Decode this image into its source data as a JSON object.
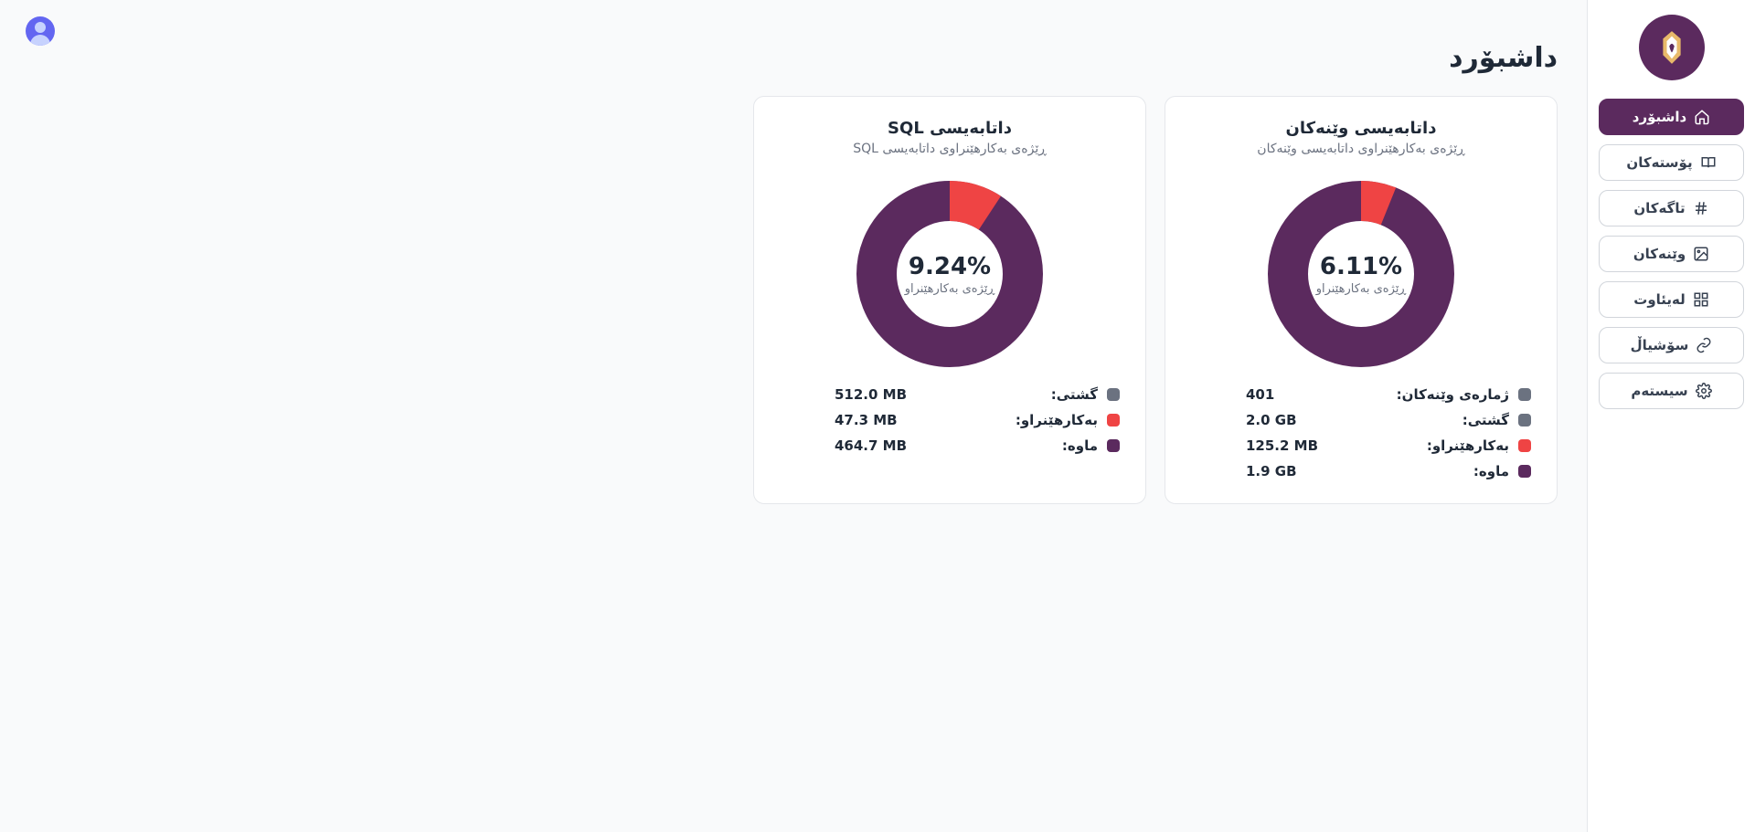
{
  "colors": {
    "primary": "#5b2a5e",
    "accent": "#ef4444",
    "muted": "#6b7280",
    "swatch_total": "#6b7280",
    "swatch_used": "#ef4444",
    "swatch_remaining": "#5b2a5e"
  },
  "page": {
    "title": "داشبۆرد"
  },
  "sidebar": {
    "items": [
      {
        "id": "dashboard",
        "label": "داشبۆرد",
        "icon": "home",
        "active": true
      },
      {
        "id": "posts",
        "label": "پۆستەکان",
        "icon": "book",
        "active": false
      },
      {
        "id": "tags",
        "label": "تاگەکان",
        "icon": "hash",
        "active": false
      },
      {
        "id": "images",
        "label": "وێنەکان",
        "icon": "image",
        "active": false
      },
      {
        "id": "categories",
        "label": "لەیئاوت",
        "icon": "grid",
        "active": false
      },
      {
        "id": "social",
        "label": "سۆشیاڵ",
        "icon": "link",
        "active": false
      },
      {
        "id": "system",
        "label": "سیستەم",
        "icon": "gear",
        "active": false
      }
    ]
  },
  "cards": [
    {
      "id": "images_db",
      "title": "داتابەیسی وێنەکان",
      "subtitle": "ڕێژەی بەکارهێنراوی داتابەیسی وێنەکان",
      "percent_text": "6.11%",
      "percent_value": 6.11,
      "center_label": "ڕێژەی بەکارهێنراو",
      "rows": [
        {
          "swatch": "swatch_total",
          "label": "ژمارەی وێنەکان:",
          "value": "401"
        },
        {
          "swatch": "swatch_total",
          "label": "گشتی:",
          "value": "2.0 GB"
        },
        {
          "swatch": "swatch_used",
          "label": "بەکارهێنراو:",
          "value": "125.2 MB"
        },
        {
          "swatch": "swatch_remaining",
          "label": "ماوە:",
          "value": "1.9 GB"
        }
      ]
    },
    {
      "id": "sql_db",
      "title": "داتابەیسی SQL",
      "subtitle": "ڕێژەی بەکارهێنراوی داتابەیسی SQL",
      "percent_text": "9.24%",
      "percent_value": 9.24,
      "center_label": "ڕێژەی بەکارهێنراو",
      "rows": [
        {
          "swatch": "swatch_total",
          "label": "گشتی:",
          "value": "512.0 MB"
        },
        {
          "swatch": "swatch_used",
          "label": "بەکارهێنراو:",
          "value": "47.3 MB"
        },
        {
          "swatch": "swatch_remaining",
          "label": "ماوە:",
          "value": "464.7 MB"
        }
      ]
    }
  ],
  "chart_data": [
    {
      "type": "pie",
      "title": "داتابەیسی وێنەکان",
      "series": [
        {
          "name": "بەکارهێنراو",
          "value": 6.11
        },
        {
          "name": "ماوە",
          "value": 93.89
        }
      ],
      "unit": "%"
    },
    {
      "type": "pie",
      "title": "داتابەیسی SQL",
      "series": [
        {
          "name": "بەکارهێنراو",
          "value": 9.24
        },
        {
          "name": "ماوە",
          "value": 90.76
        }
      ],
      "unit": "%"
    }
  ]
}
